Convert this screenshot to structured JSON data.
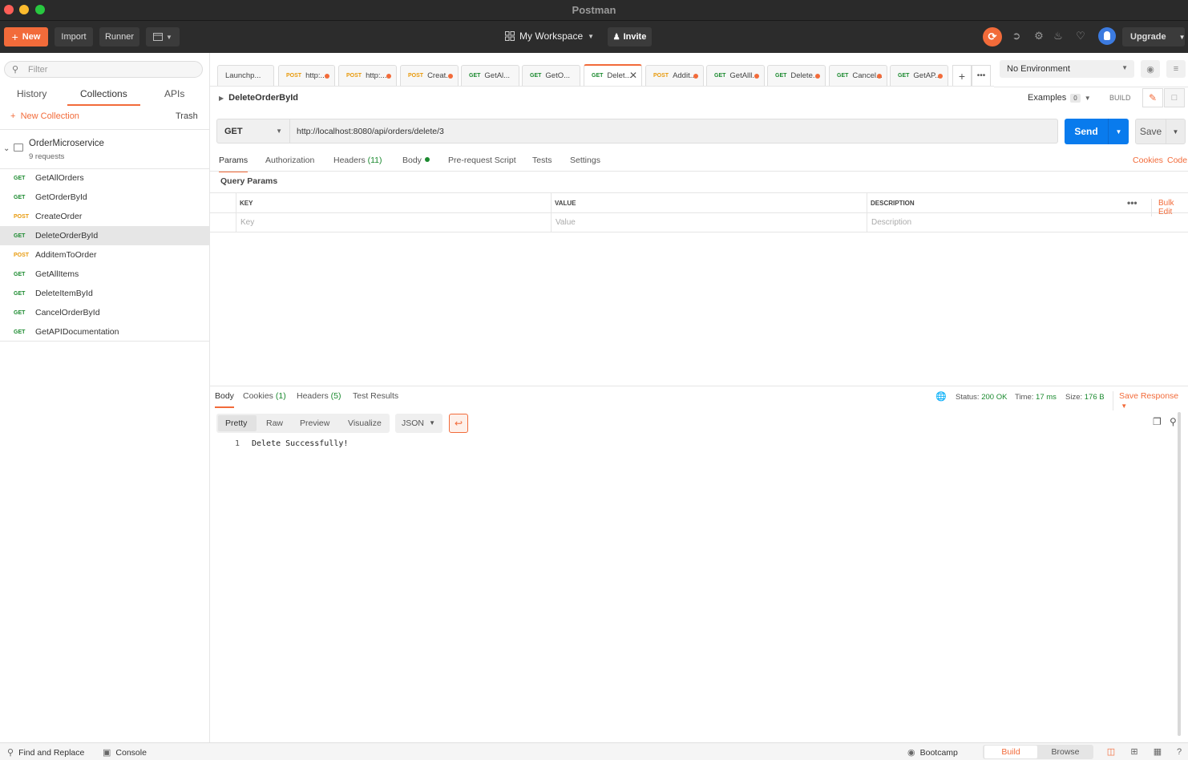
{
  "window": {
    "title": "Postman"
  },
  "header": {
    "new_label": "New",
    "import_label": "Import",
    "runner_label": "Runner",
    "workspace_label": "My Workspace",
    "invite_label": "Invite",
    "upgrade_label": "Upgrade"
  },
  "sidebar": {
    "filter_placeholder": "Filter",
    "tabs": [
      "History",
      "Collections",
      "APIs"
    ],
    "active_tab": "Collections",
    "new_collection_label": "New Collection",
    "trash_label": "Trash",
    "collection": {
      "name": "OrderMicroservice",
      "count": "9 requests"
    },
    "requests": [
      {
        "method": "GET",
        "name": "GetAllOrders"
      },
      {
        "method": "GET",
        "name": "GetOrderById"
      },
      {
        "method": "POST",
        "name": "CreateOrder"
      },
      {
        "method": "GET",
        "name": "DeleteOrderById",
        "selected": true
      },
      {
        "method": "POST",
        "name": "AdditemToOrder"
      },
      {
        "method": "GET",
        "name": "GetAllItems"
      },
      {
        "method": "GET",
        "name": "DeleteItemById"
      },
      {
        "method": "GET",
        "name": "CancelOrderById"
      },
      {
        "method": "GET",
        "name": "GetAPIDocumentation"
      }
    ]
  },
  "tabs": [
    {
      "method": "",
      "label": "Launchp...",
      "dot": false
    },
    {
      "method": "POST",
      "label": "http:...",
      "dot": true
    },
    {
      "method": "POST",
      "label": "http:...",
      "dot": true
    },
    {
      "method": "POST",
      "label": "Creat...",
      "dot": true
    },
    {
      "method": "GET",
      "label": "GetAl...",
      "dot": false
    },
    {
      "method": "GET",
      "label": "GetO...",
      "dot": false
    },
    {
      "method": "GET",
      "label": "Delet...",
      "dot": false,
      "active": true
    },
    {
      "method": "POST",
      "label": "Addit...",
      "dot": true
    },
    {
      "method": "GET",
      "label": "GetAlll...",
      "dot": true
    },
    {
      "method": "GET",
      "label": "Delete...",
      "dot": true
    },
    {
      "method": "GET",
      "label": "Cancel...",
      "dot": true
    },
    {
      "method": "GET",
      "label": "GetAP...",
      "dot": true
    }
  ],
  "environment": {
    "selected": "No Environment"
  },
  "request": {
    "name": "DeleteOrderById",
    "examples_label": "Examples",
    "examples_count": "0",
    "build_label": "BUILD",
    "method": "GET",
    "url": "http://localhost:8080/api/orders/delete/3",
    "send_label": "Send",
    "save_label": "Save",
    "tabs": {
      "params": "Params",
      "authorization": "Authorization",
      "headers": "Headers",
      "headers_count": "(11)",
      "body": "Body",
      "prerequest": "Pre-request Script",
      "tests": "Tests",
      "settings": "Settings"
    },
    "cookies_label": "Cookies",
    "code_label": "Code",
    "query_params_title": "Query Params",
    "table": {
      "headers": [
        "KEY",
        "VALUE",
        "DESCRIPTION"
      ],
      "placeholders": [
        "Key",
        "Value",
        "Description"
      ],
      "bulk_edit_label": "Bulk Edit"
    }
  },
  "response": {
    "tabs": {
      "body": "Body",
      "cookies": "Cookies",
      "cookies_count": "(1)",
      "headers": "Headers",
      "headers_count": "(5)",
      "test_results": "Test Results"
    },
    "status_label": "Status:",
    "status_value": "200 OK",
    "time_label": "Time:",
    "time_value": "17 ms",
    "size_label": "Size:",
    "size_value": "176 B",
    "save_response_label": "Save Response",
    "format_tabs": [
      "Pretty",
      "Raw",
      "Preview",
      "Visualize"
    ],
    "format_select": "JSON",
    "body_lines": [
      {
        "number": "1",
        "text": "Delete Successfully!"
      }
    ]
  },
  "footer": {
    "find_replace_label": "Find and Replace",
    "console_label": "Console",
    "bootcamp_label": "Bootcamp",
    "build_label": "Build",
    "browse_label": "Browse"
  },
  "colors": {
    "accent": "#f26b3a",
    "send": "#097bed",
    "get": "#1b8a2f",
    "post": "#e89a0c"
  }
}
